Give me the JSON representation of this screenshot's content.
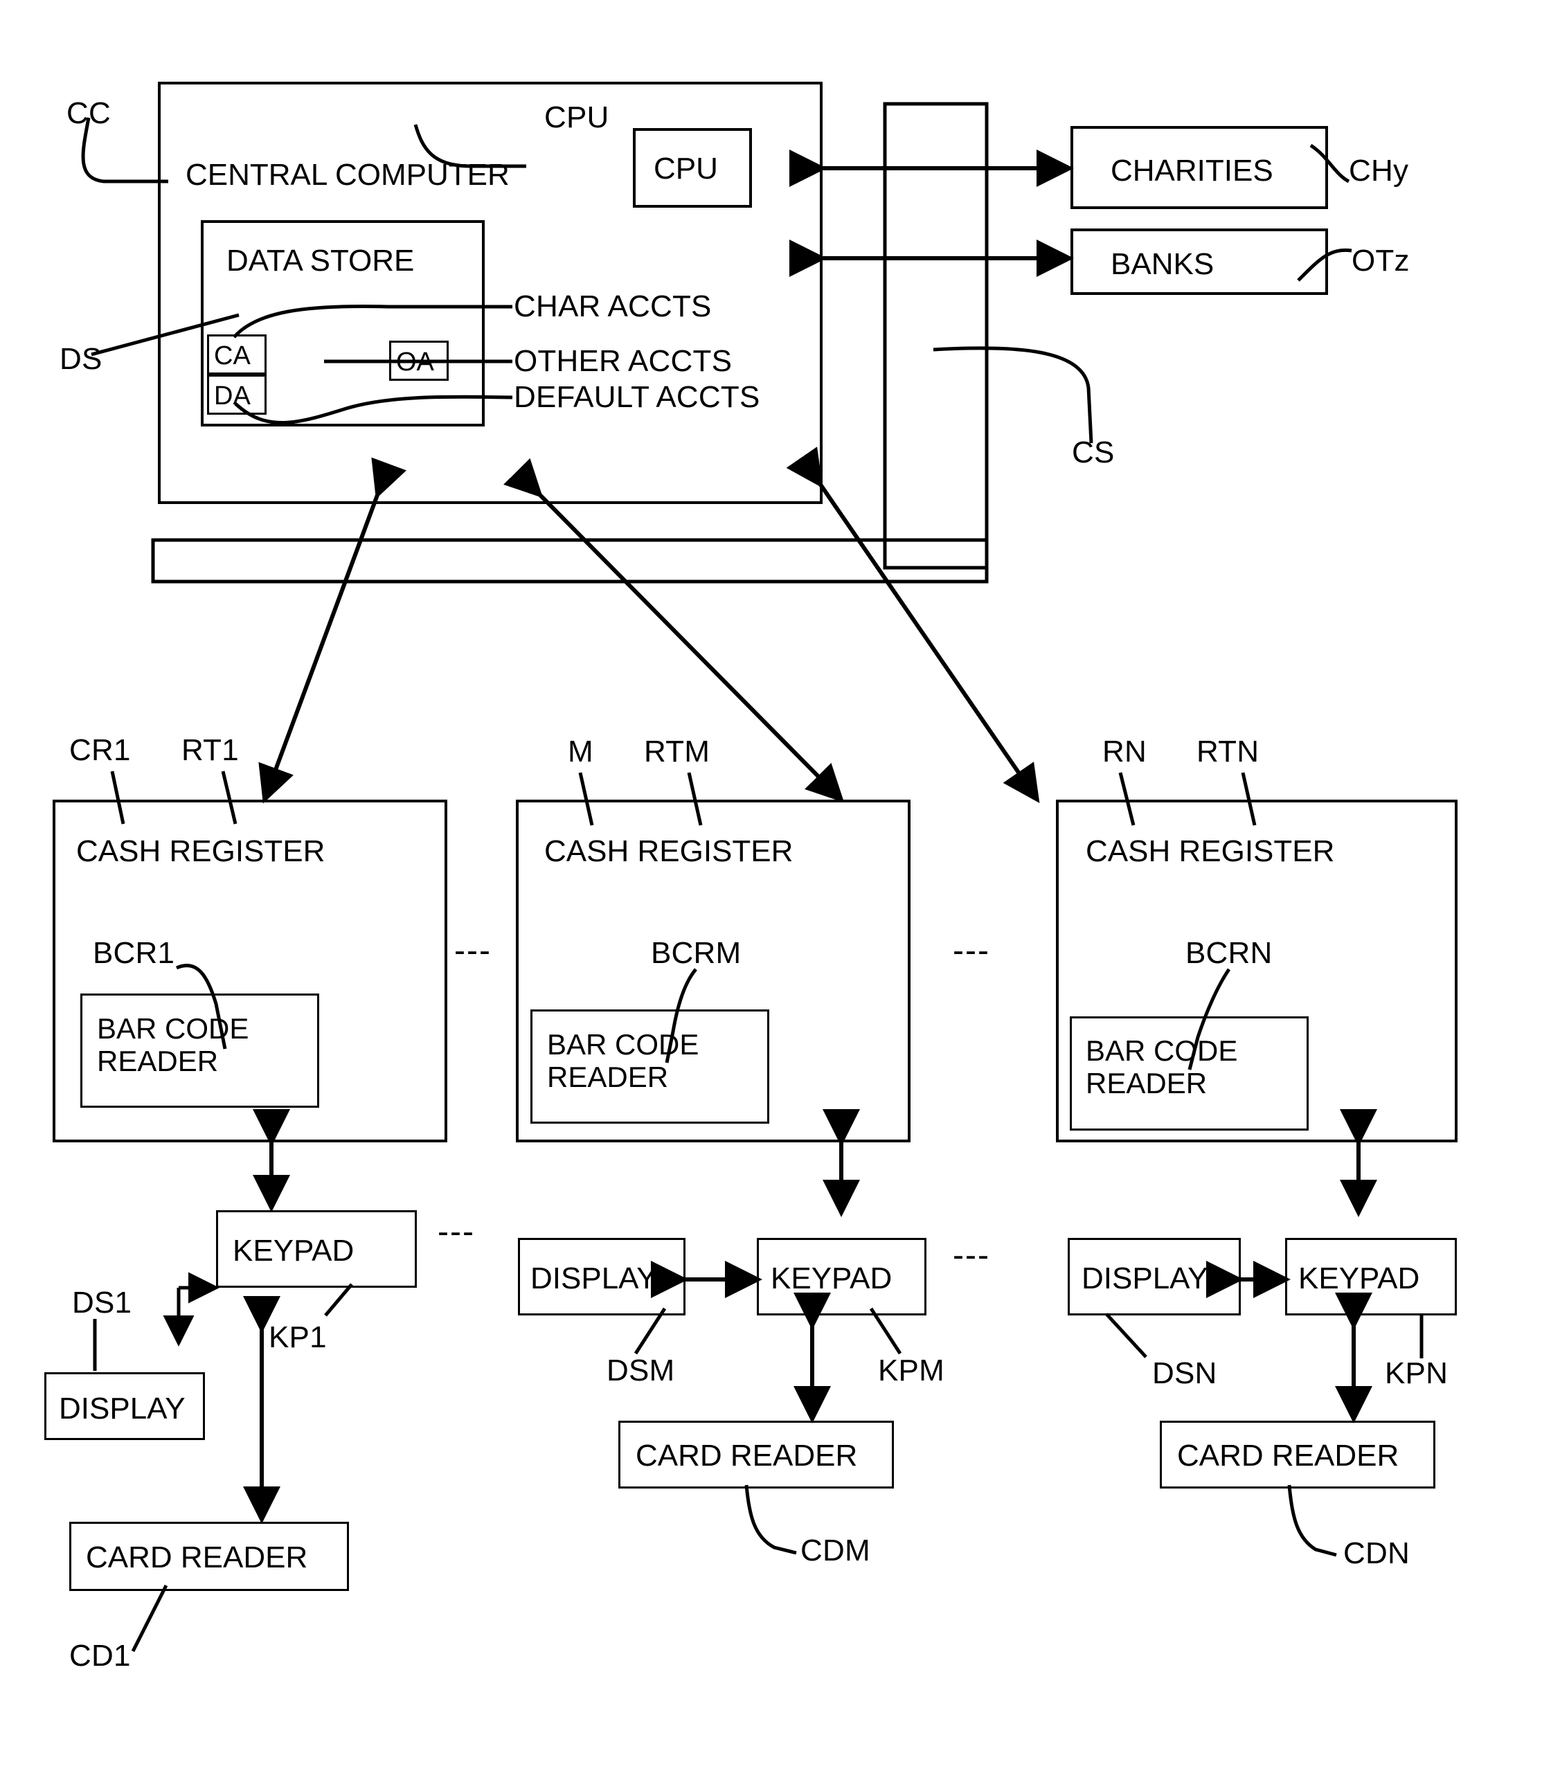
{
  "figure": {
    "type": "patent-block-diagram",
    "title": "Charitable donation point-of-sale network block diagram"
  },
  "central_computer": {
    "box_label": "CENTRAL COMPUTER",
    "ref": "CC",
    "cpu": {
      "box_label": "CPU",
      "ref": "CPU"
    },
    "data_store": {
      "box_label": "DATA STORE",
      "ref": "DS",
      "account_boxes": [
        {
          "ref": "CA",
          "name": "char-accounts-box"
        },
        {
          "ref": "DA",
          "name": "default-accounts-box"
        },
        {
          "ref": "OA",
          "name": "other-accounts-box"
        }
      ],
      "account_labels": [
        "CHAR ACCTS",
        "OTHER ACCTS",
        "DEFAULT ACCTS"
      ]
    }
  },
  "external": {
    "charities": {
      "box_label": "CHARITIES",
      "ref": "CHy"
    },
    "banks": {
      "box_label": "BANKS",
      "ref": "OTz"
    },
    "comms_bus_ref": "CS"
  },
  "registers": [
    {
      "box_label": "CASH REGISTER",
      "unit_ref": "CR1",
      "terminal_ref": "RT1",
      "bar_code_reader": {
        "line1": "BAR CODE",
        "line2": "READER",
        "ref": "BCR1"
      },
      "keypad": {
        "box_label": "KEYPAD",
        "ref": "KP1"
      },
      "display": {
        "box_label": "DISPLAY",
        "ref": "DS1"
      },
      "card_reader": {
        "box_label": "CARD READER",
        "ref": "CD1"
      }
    },
    {
      "box_label": "CASH REGISTER",
      "unit_ref": "M",
      "terminal_ref": "RTM",
      "bar_code_reader": {
        "line1": "BAR CODE",
        "line2": "READER",
        "ref": "BCRM"
      },
      "keypad": {
        "box_label": "KEYPAD",
        "ref": "KPM"
      },
      "display": {
        "box_label": "DISPLAY",
        "ref": "DSM"
      },
      "card_reader": {
        "box_label": "CARD READER",
        "ref": "CDM"
      }
    },
    {
      "box_label": "CASH REGISTER",
      "unit_ref": "RN",
      "terminal_ref": "RTN",
      "bar_code_reader": {
        "line1": "BAR CODE",
        "line2": "READER",
        "ref": "BCRN"
      },
      "keypad": {
        "box_label": "KEYPAD",
        "ref": "KPN"
      },
      "display": {
        "box_label": "DISPLAY",
        "ref": "DSN"
      },
      "card_reader": {
        "box_label": "CARD READER",
        "ref": "CDN"
      }
    }
  ],
  "ellipses": {
    "register_row": "---",
    "keypad_row": "---"
  },
  "colors": {
    "ink": "#000000",
    "paper": "#ffffff"
  }
}
